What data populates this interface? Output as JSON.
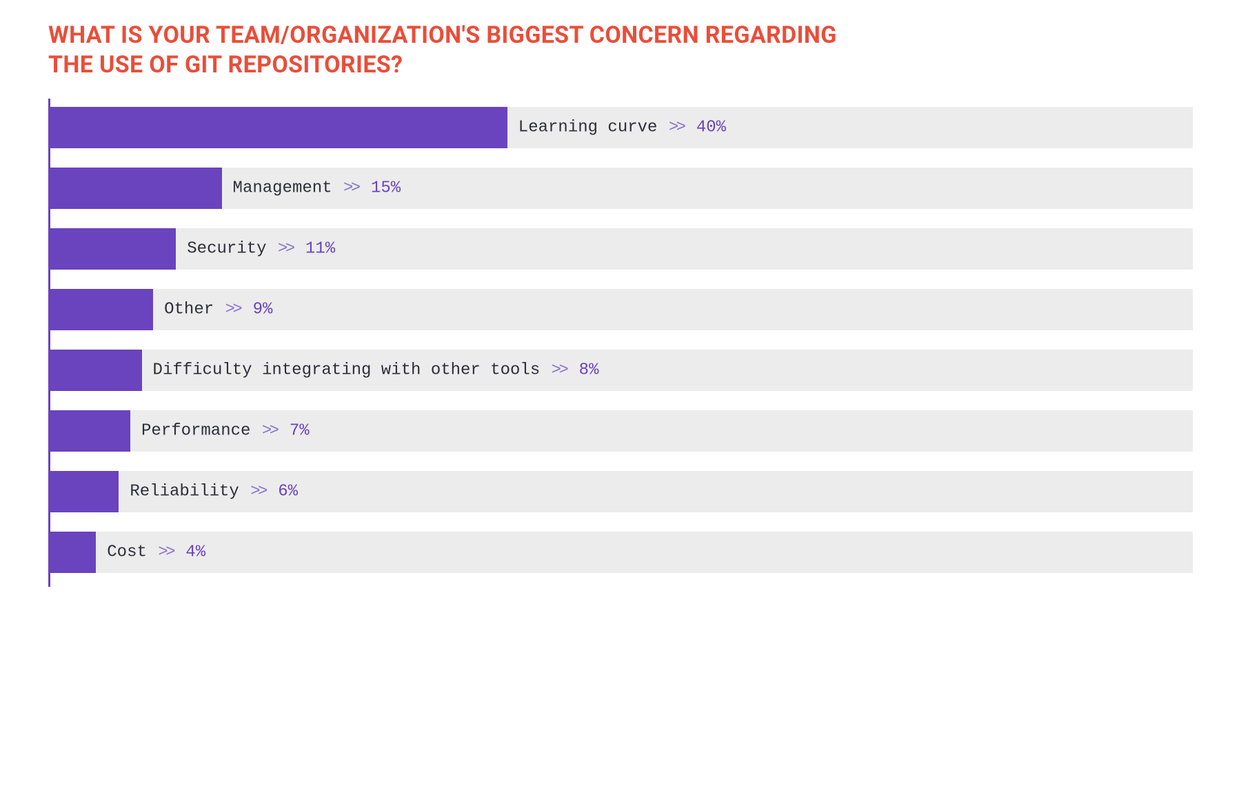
{
  "title": "WHAT IS YOUR TEAM/ORGANIZATION'S BIGGEST CONCERN REGARDING THE USE OF GIT REPOSITORIES?",
  "chevron": ">>",
  "chart_data": {
    "type": "bar",
    "orientation": "horizontal",
    "title": "WHAT IS YOUR TEAM/ORGANIZATION'S BIGGEST CONCERN REGARDING THE USE OF GIT REPOSITORIES?",
    "xlabel": "",
    "ylabel": "",
    "xlim": [
      0,
      100
    ],
    "unit": "%",
    "categories": [
      "Learning curve",
      "Management",
      "Security",
      "Other",
      "Difficulty integrating with other tools",
      "Performance",
      "Reliability",
      "Cost"
    ],
    "values": [
      40,
      15,
      11,
      9,
      8,
      7,
      6,
      4
    ],
    "bar_color": "#6a43be",
    "track_color": "#ececec",
    "axis_color": "#6a43be",
    "title_color": "#e94e3a"
  }
}
